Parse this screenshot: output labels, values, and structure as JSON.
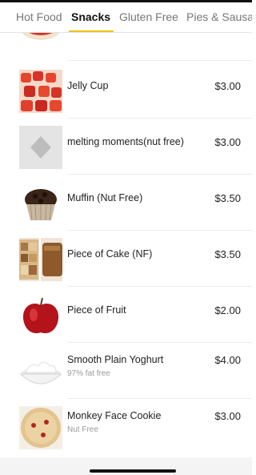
{
  "tabs": [
    {
      "label": "Hot Food",
      "active": false
    },
    {
      "label": "Snacks",
      "active": true
    },
    {
      "label": "Gluten Free",
      "active": false
    },
    {
      "label": "Pies & Sausa",
      "active": false
    }
  ],
  "items": [
    {
      "name": "Jelly Cup",
      "price": "$3.00",
      "subtitle": "",
      "image": "jelly-cup-image"
    },
    {
      "name": "melting moments(nut free)",
      "price": "$3.00",
      "subtitle": "",
      "image": "placeholder-image"
    },
    {
      "name": "Muffin (Nut Free)",
      "price": "$3.50",
      "subtitle": "",
      "image": "muffin-image"
    },
    {
      "name": "Piece of Cake (NF)",
      "price": "$3.50",
      "subtitle": "",
      "image": "cake-image"
    },
    {
      "name": "Piece of Fruit",
      "price": "$2.00",
      "subtitle": "",
      "image": "apple-image"
    },
    {
      "name": "Smooth Plain Yoghurt",
      "price": "$4.00",
      "subtitle": "97% fat free",
      "image": "yoghurt-image"
    },
    {
      "name": "Monkey Face Cookie",
      "price": "$3.00",
      "subtitle": "Nut Free",
      "image": "cookie-image"
    }
  ],
  "colors": {
    "accent": "#f2c200",
    "tab_active": "#111111",
    "tab_inactive": "#777777"
  }
}
